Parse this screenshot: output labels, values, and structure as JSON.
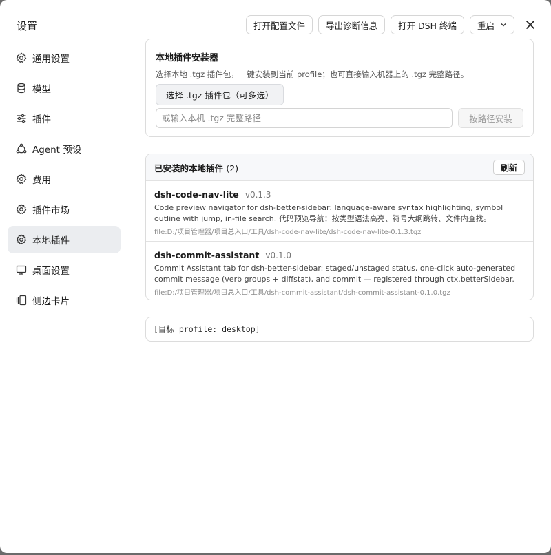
{
  "window": {
    "title": "设置"
  },
  "toolbar": {
    "open_config": "打开配置文件",
    "export_diag": "导出诊断信息",
    "open_terminal": "打开 DSH 终端",
    "restart": "重启"
  },
  "sidebar": {
    "items": [
      {
        "label": "通用设置",
        "icon": "gear-icon"
      },
      {
        "label": "模型",
        "icon": "database-icon"
      },
      {
        "label": "插件",
        "icon": "sliders-icon"
      },
      {
        "label": "Agent 预设",
        "icon": "agent-icon"
      },
      {
        "label": "费用",
        "icon": "gear-icon"
      },
      {
        "label": "插件市场",
        "icon": "gear-icon"
      },
      {
        "label": "本地插件",
        "icon": "gear-icon",
        "active": true
      },
      {
        "label": "桌面设置",
        "icon": "monitor-icon"
      },
      {
        "label": "侧边卡片",
        "icon": "cards-icon"
      }
    ]
  },
  "installer": {
    "title": "本地插件安装器",
    "description": "选择本地 .tgz 插件包，一键安装到当前 profile；也可直接输入机器上的 .tgz 完整路径。",
    "pick_button": "选择 .tgz 插件包（可多选）",
    "path_placeholder": "或输入本机 .tgz 完整路径",
    "path_value": "",
    "install_path_button": "按路径安装"
  },
  "installed": {
    "title": "已安装的本地插件",
    "count": "(2)",
    "refresh": "刷新",
    "plugins": [
      {
        "name": "dsh-code-nav-lite",
        "version": "v0.1.3",
        "description": "Code preview navigator for dsh-better-sidebar: language-aware syntax highlighting, symbol outline with jump, in-file search. 代码预览导航：按类型语法高亮、符号大纲跳转、文件内查找。",
        "file": "file:D:/项目管理器/项目总入口/工具/dsh-code-nav-lite/dsh-code-nav-lite-0.1.3.tgz"
      },
      {
        "name": "dsh-commit-assistant",
        "version": "v0.1.0",
        "description": "Commit Assistant tab for dsh-better-sidebar: staged/unstaged status, one-click auto-generated commit message (verb groups + diffstat), and commit — registered through ctx.betterSidebar.",
        "file": "file:D:/项目管理器/项目总入口/工具/dsh-commit-assistant/dsh-commit-assistant-0.1.0.tgz"
      }
    ]
  },
  "target_line": "[目标 profile: desktop]"
}
